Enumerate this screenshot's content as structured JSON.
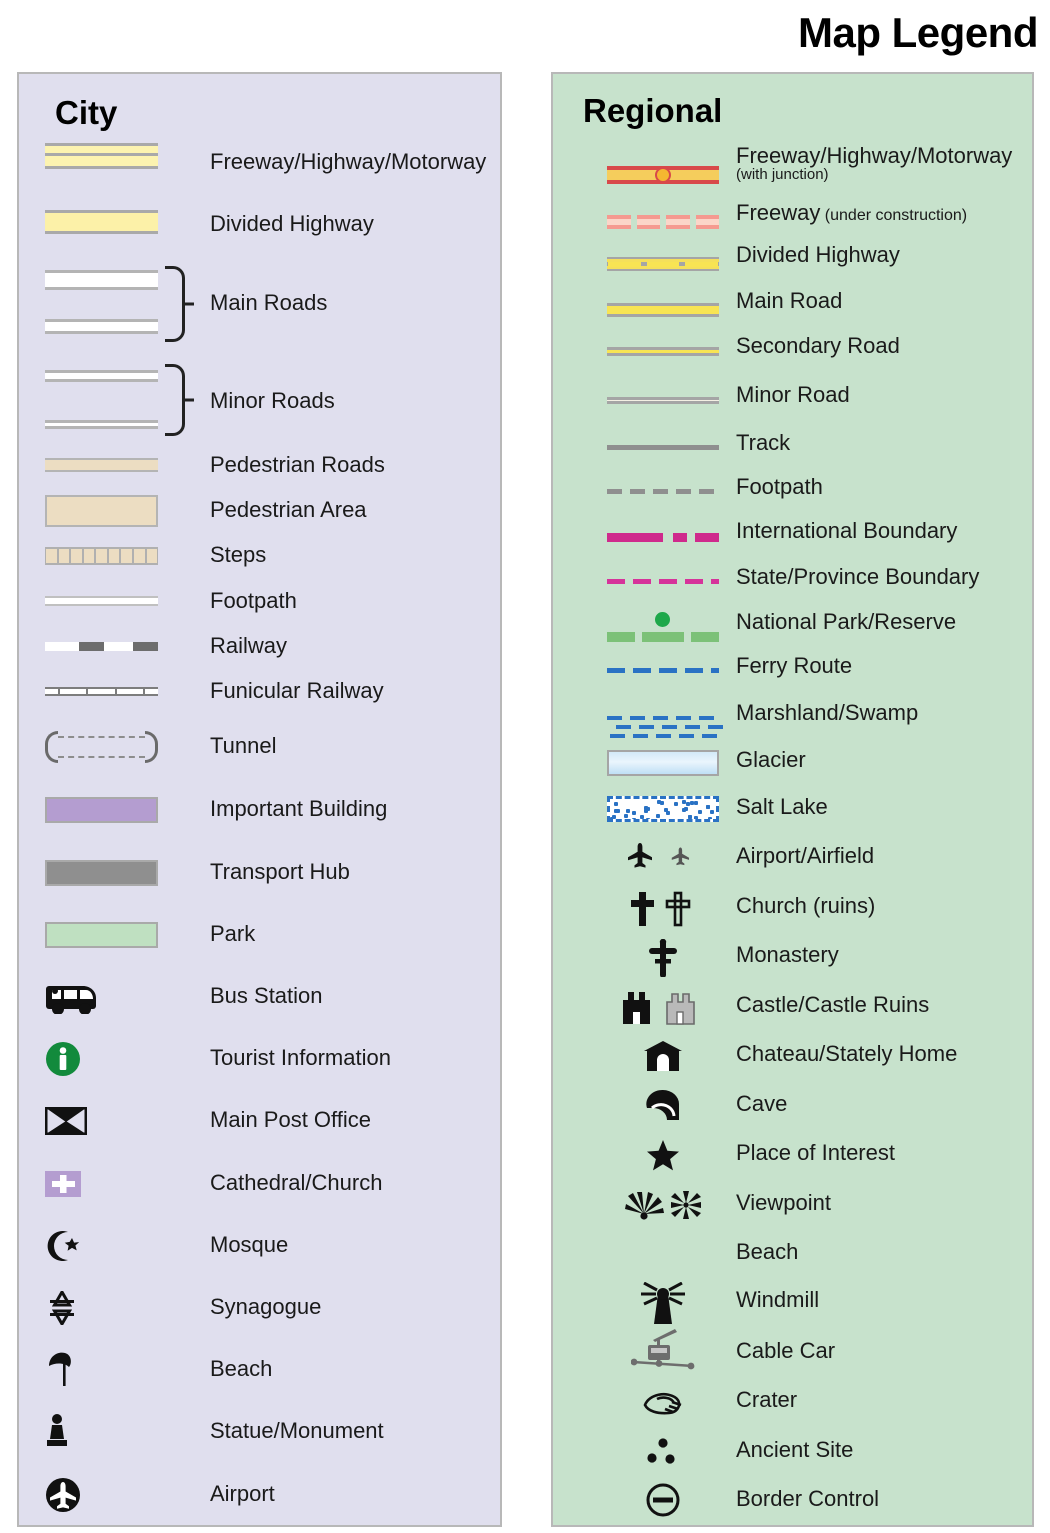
{
  "title": "Map Legend",
  "panels": {
    "city": {
      "heading": "City",
      "background": "#e0dfee",
      "items": [
        {
          "label": "Freeway/Highway/Motorway",
          "icon": "freeway-swatch"
        },
        {
          "label": "Divided Highway",
          "icon": "divided-highway-swatch"
        },
        {
          "label": "Main Roads",
          "icon": "main-roads-swatch"
        },
        {
          "label": "Minor Roads",
          "icon": "minor-roads-swatch"
        },
        {
          "label": "Pedestrian Roads",
          "icon": "pedestrian-road-swatch"
        },
        {
          "label": "Pedestrian Area",
          "icon": "pedestrian-area-swatch"
        },
        {
          "label": "Steps",
          "icon": "steps-swatch"
        },
        {
          "label": "Footpath",
          "icon": "footpath-swatch"
        },
        {
          "label": "Railway",
          "icon": "railway-swatch"
        },
        {
          "label": "Funicular Railway",
          "icon": "funicular-railway-swatch"
        },
        {
          "label": "Tunnel",
          "icon": "tunnel-swatch"
        },
        {
          "label": "Important Building",
          "icon": "important-building-swatch"
        },
        {
          "label": "Transport Hub",
          "icon": "transport-hub-swatch"
        },
        {
          "label": "Park",
          "icon": "park-swatch"
        },
        {
          "label": "Bus Station",
          "icon": "bus-icon"
        },
        {
          "label": "Tourist Information",
          "icon": "info-icon"
        },
        {
          "label": "Main Post Office",
          "icon": "envelope-icon"
        },
        {
          "label": "Cathedral/Church",
          "icon": "church-cross-icon"
        },
        {
          "label": "Mosque",
          "icon": "star-and-crescent-icon"
        },
        {
          "label": "Synagogue",
          "icon": "star-of-david-icon"
        },
        {
          "label": "Beach",
          "icon": "beach-umbrella-icon"
        },
        {
          "label": "Statue/Monument",
          "icon": "statue-icon"
        },
        {
          "label": "Airport",
          "icon": "airplane-circle-icon"
        }
      ]
    },
    "regional": {
      "heading": "Regional",
      "background": "#c7e2cc",
      "items": [
        {
          "label": "Freeway/Highway/Motorway",
          "sublabel": "(with junction)",
          "sub_style": "block",
          "icon": "regional-freeway-swatch"
        },
        {
          "label": "Freeway",
          "sublabel": "(under construction)",
          "sub_style": "inline",
          "icon": "freeway-under-construction-swatch"
        },
        {
          "label": "Divided Highway",
          "icon": "regional-divided-highway-swatch"
        },
        {
          "label": "Main Road",
          "icon": "regional-main-road-swatch"
        },
        {
          "label": "Secondary Road",
          "icon": "secondary-road-swatch"
        },
        {
          "label": "Minor Road",
          "icon": "regional-minor-road-swatch"
        },
        {
          "label": "Track",
          "icon": "track-swatch"
        },
        {
          "label": "Footpath",
          "icon": "regional-footpath-swatch"
        },
        {
          "label": "International Boundary",
          "icon": "international-boundary-swatch"
        },
        {
          "label": "State/Province Boundary",
          "icon": "state-boundary-swatch"
        },
        {
          "label": "National Park/Reserve",
          "icon": "national-park-swatch"
        },
        {
          "label": "Ferry Route",
          "icon": "ferry-route-swatch"
        },
        {
          "label": "Marshland/Swamp",
          "icon": "marshland-swatch"
        },
        {
          "label": "Glacier",
          "icon": "glacier-swatch"
        },
        {
          "label": "Salt Lake",
          "icon": "salt-lake-swatch"
        },
        {
          "label": "Airport/Airfield",
          "icon": "airport-airfield-icon"
        },
        {
          "label": "Church (ruins)",
          "icon": "church-ruins-icon"
        },
        {
          "label": "Monastery",
          "icon": "monastery-cross-icon"
        },
        {
          "label": "Castle/Castle Ruins",
          "icon": "castle-icon"
        },
        {
          "label": "Chateau/Stately Home",
          "icon": "chateau-icon"
        },
        {
          "label": "Cave",
          "icon": "cave-icon"
        },
        {
          "label": "Place of Interest",
          "icon": "star-icon"
        },
        {
          "label": "Viewpoint",
          "icon": "viewpoint-icon"
        },
        {
          "label": "Beach",
          "icon": "beach-umbrella-icon"
        },
        {
          "label": "Windmill",
          "icon": "windmill-icon"
        },
        {
          "label": "Cable Car",
          "icon": "cable-car-icon"
        },
        {
          "label": "Crater",
          "icon": "crater-icon"
        },
        {
          "label": "Ancient Site",
          "icon": "ancient-site-icon"
        },
        {
          "label": "Border Control",
          "icon": "border-control-icon"
        }
      ]
    }
  },
  "colors": {
    "city_panel": "#e0dfee",
    "regional_panel": "#c7e2cc",
    "highway_yellow": "#fcf1a8",
    "freeway_red": "#d8494a",
    "road_yellow": "#f8e453",
    "boundary_magenta": "#cf2a8c",
    "ferry_blue": "#2a72c4",
    "park_green": "#7cc178",
    "important_building_purple": "#b49dd0",
    "transport_hub_grey": "#8f8f8f",
    "park_swatch_green": "#bfe0c1",
    "pedestrian_beige": "#ecddc2",
    "tourist_info_green": "#128a3c"
  }
}
